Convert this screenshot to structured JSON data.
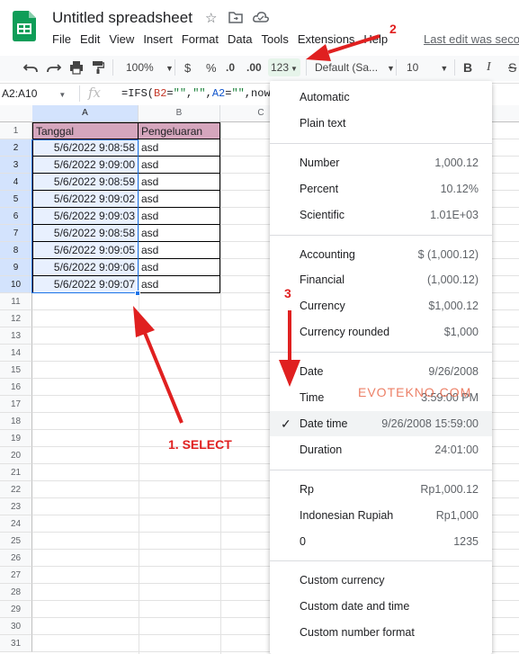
{
  "app": {
    "title": "Untitled spreadsheet",
    "last_edit": "Last edit was seco",
    "menu": [
      "File",
      "Edit",
      "View",
      "Insert",
      "Format",
      "Data",
      "Tools",
      "Extensions",
      "Help"
    ]
  },
  "toolbar": {
    "zoom": "100%",
    "currency": "$",
    "percent": "%",
    "dec_decrease": ".0",
    "dec_increase": ".00",
    "more_formats": "123",
    "font": "Default (Sa...",
    "font_size": "10",
    "bold": "B",
    "italic": "I",
    "strike": "S"
  },
  "formula_bar": {
    "name_box": "A2:A10",
    "fx": "fx",
    "formula_parts": [
      "=IFS(",
      "B2",
      "=",
      "\"\"",
      ",",
      "\"\"",
      ",",
      "A2",
      "=",
      "\"\"",
      ",now(),"
    ]
  },
  "grid": {
    "columns": [
      "A",
      "B",
      "C"
    ],
    "rows": [
      "1",
      "2",
      "3",
      "4",
      "5",
      "6",
      "7",
      "8",
      "9",
      "10",
      "11",
      "12",
      "13",
      "14",
      "15",
      "16",
      "17",
      "18",
      "19",
      "20",
      "21",
      "22",
      "23",
      "24",
      "25",
      "26",
      "27",
      "28",
      "29",
      "30",
      "31"
    ],
    "header": [
      "Tanggal",
      "Pengeluaran"
    ],
    "data": [
      [
        "5/6/2022 9:08:58",
        "asd"
      ],
      [
        "5/6/2022 9:09:00",
        "asd"
      ],
      [
        "5/6/2022 9:08:59",
        "asd"
      ],
      [
        "5/6/2022 9:09:02",
        "asd"
      ],
      [
        "5/6/2022 9:09:03",
        "asd"
      ],
      [
        "5/6/2022 9:08:58",
        "asd"
      ],
      [
        "5/6/2022 9:09:05",
        "asd"
      ],
      [
        "5/6/2022 9:09:06",
        "asd"
      ],
      [
        "5/6/2022 9:09:07",
        "asd"
      ]
    ]
  },
  "format_menu": {
    "groups": [
      [
        {
          "label": "Automatic",
          "value": ""
        },
        {
          "label": "Plain text",
          "value": ""
        }
      ],
      [
        {
          "label": "Number",
          "value": "1,000.12"
        },
        {
          "label": "Percent",
          "value": "10.12%"
        },
        {
          "label": "Scientific",
          "value": "1.01E+03"
        }
      ],
      [
        {
          "label": "Accounting",
          "value": "$ (1,000.12)"
        },
        {
          "label": "Financial",
          "value": "(1,000.12)"
        },
        {
          "label": "Currency",
          "value": "$1,000.12"
        },
        {
          "label": "Currency rounded",
          "value": "$1,000"
        }
      ],
      [
        {
          "label": "Date",
          "value": "9/26/2008"
        },
        {
          "label": "Time",
          "value": "3:59:00 PM"
        },
        {
          "label": "Date time",
          "value": "9/26/2008 15:59:00",
          "checked": true
        },
        {
          "label": "Duration",
          "value": "24:01:00"
        }
      ],
      [
        {
          "label": "Rp",
          "value": "Rp1,000.12"
        },
        {
          "label": "Indonesian Rupiah",
          "value": "Rp1,000"
        },
        {
          "label": "0",
          "value": "1235"
        }
      ],
      [
        {
          "label": "Custom currency",
          "value": ""
        },
        {
          "label": "Custom date and time",
          "value": ""
        },
        {
          "label": "Custom number format",
          "value": ""
        }
      ]
    ]
  },
  "annotations": {
    "select_label": "1. SELECT",
    "step2": "2",
    "step3": "3",
    "watermark": "EVOTEKNO.COM",
    "color": "#e02020"
  },
  "colors": {
    "header_fill": "#d5a6bd",
    "selection_fill": "#e8f0fe",
    "selection_border": "#1a73e8",
    "sheets_green": "#0f9d58",
    "format_button_fill": "#e6f4ea"
  }
}
